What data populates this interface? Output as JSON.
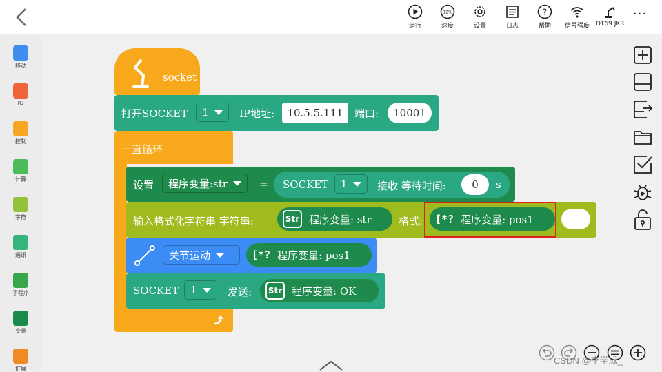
{
  "toolbar": {
    "run": "运行",
    "speed": "速度",
    "speed_value": "12%",
    "settings": "设置",
    "log": "日志",
    "help": "帮助",
    "signal": "信号强度",
    "robot": "DT69 JKR",
    "more": "···"
  },
  "sidebar": {
    "items": [
      {
        "label": "移动",
        "color": "#3e8ef0"
      },
      {
        "label": "IO",
        "color": "#f0643c"
      },
      {
        "label": "控制",
        "color": "#f6a623"
      },
      {
        "label": "计算",
        "color": "#4cbb5a"
      },
      {
        "label": "字符",
        "color": "#95c23d"
      },
      {
        "label": "通讯",
        "color": "#33b57b"
      },
      {
        "label": "子程序",
        "color": "#3aa64c"
      },
      {
        "label": "变量",
        "color": "#1b8a4d"
      },
      {
        "label": "扩展",
        "color": "#f08a24"
      }
    ]
  },
  "blocks": {
    "socket_hat": "socket",
    "open_socket": {
      "label": "打开SOCKET",
      "num": "1",
      "ip_label": "IP地址:",
      "ip": "10.5.5.111",
      "port_label": "端口:",
      "port": "10001"
    },
    "loop": "一直循环",
    "set": {
      "label": "设置",
      "var": "程序变量:str",
      "eq": "=",
      "socket": "SOCKET",
      "num": "1",
      "recv": "接收 等待时间:",
      "time": "0",
      "unit": "s"
    },
    "format": {
      "label": "输入格式化字符串 字符串:",
      "str_icon": "Str",
      "str_var": "程序变量: str",
      "fmt_label": "格式:",
      "fmt_icon": "[*?",
      "fmt_var": "程序变量: pos1"
    },
    "joint": {
      "mode": "关节运动",
      "icon": "[*?",
      "var": "程序变量: pos1"
    },
    "send": {
      "label": "SOCKET",
      "num": "1",
      "send": "发送:",
      "icon": "Str",
      "var": "程序变量: OK"
    }
  },
  "watermark": "CSDN @李学成_",
  "colors": {
    "teal": "#2aa884",
    "orange": "#f7a81b",
    "dark_green": "#1e8a4b",
    "olive": "#9fbb1d",
    "blue": "#3b8cf5",
    "highlight": "#e0201e"
  }
}
